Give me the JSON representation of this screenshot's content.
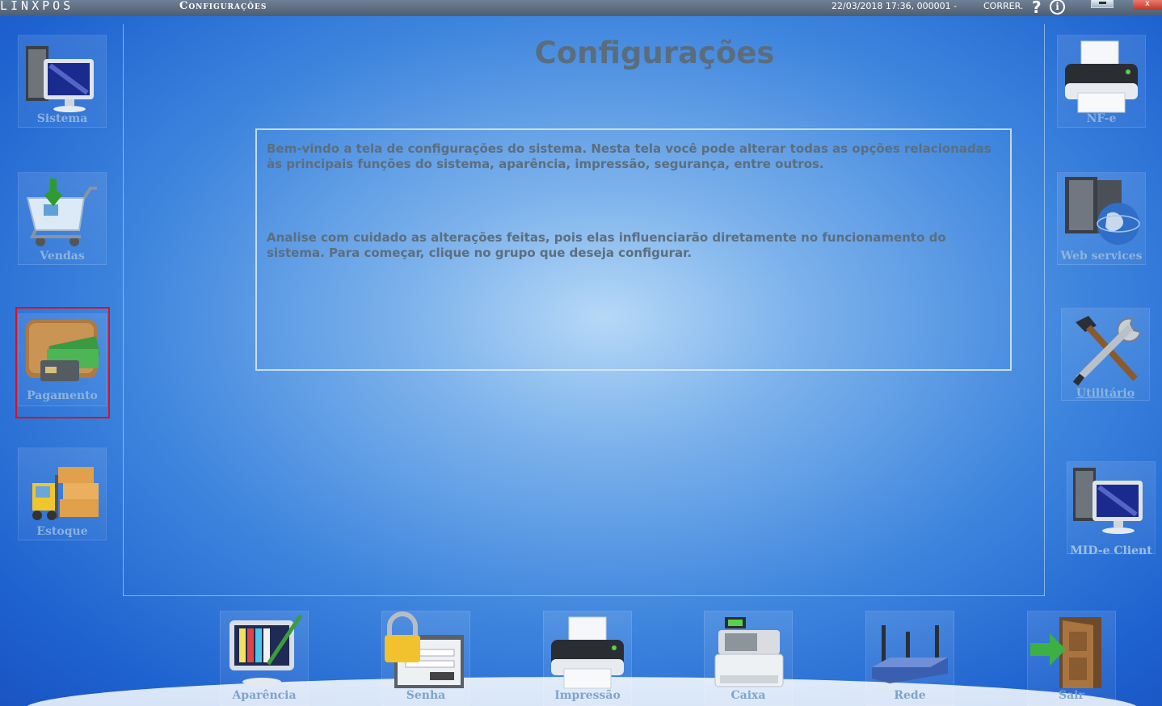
{
  "titlebar": {
    "brand": "LINXPOS",
    "title": "Configurações",
    "timestamp": "22/03/2018 17:36, 000001 -",
    "user": "CORRER.",
    "help": "?",
    "info": "i",
    "close": "x"
  },
  "page": {
    "heading": "Configurações",
    "paragraph1": "Bem-vindo a tela de configurações do sistema. Nesta tela você pode alterar todas as opções relacionadas às principais funções do sistema, aparência, impressão, segurança, entre outros.",
    "paragraph2": "Analise com cuidado as alterações feitas, pois elas influenciarão diretamente no funcionamento do sistema. Para começar, clique no grupo que deseja configurar."
  },
  "left_menu": [
    {
      "label": "Sistema",
      "icon": "computer-icon"
    },
    {
      "label": "Vendas",
      "icon": "shopping-cart-icon"
    },
    {
      "label": "Pagamento",
      "icon": "wallet-icon"
    },
    {
      "label": "Estoque",
      "icon": "forklift-icon"
    }
  ],
  "right_menu": [
    {
      "label": "NF-e",
      "icon": "printer-icon"
    },
    {
      "label": "Web services",
      "icon": "server-globe-icon"
    },
    {
      "label": "Utilitário",
      "icon": "tools-icon"
    },
    {
      "label": "MID-e Client",
      "icon": "computer-icon"
    }
  ],
  "bottom_menu": [
    {
      "label": "Aparência",
      "icon": "monitor-palette-icon"
    },
    {
      "label": "Senha",
      "icon": "padlock-icon"
    },
    {
      "label": "Impressão",
      "icon": "printer-icon"
    },
    {
      "label": "Caixa",
      "icon": "cash-register-icon"
    },
    {
      "label": "Rede",
      "icon": "router-icon"
    },
    {
      "label": "Sair",
      "icon": "exit-door-icon"
    }
  ],
  "colors": {
    "highlight": "#e0101a",
    "heading": "#5b6d7c",
    "label": "#7fa4c8"
  }
}
